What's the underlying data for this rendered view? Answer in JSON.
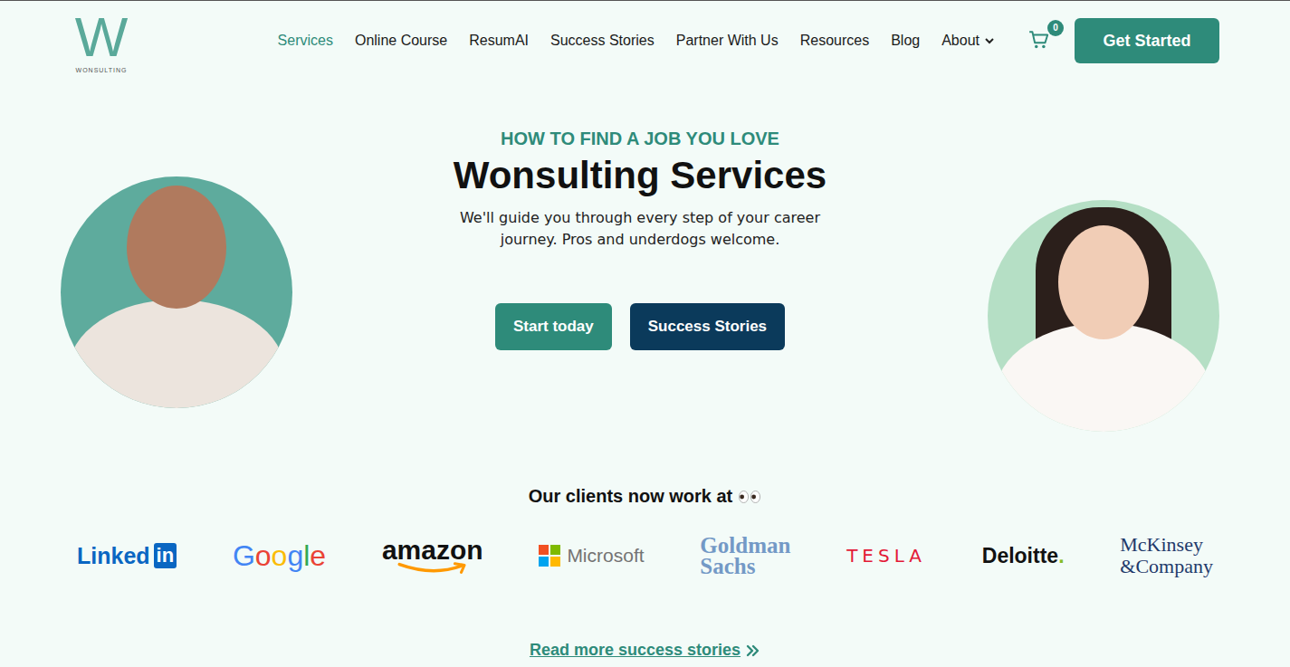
{
  "logo": {
    "letter": "W",
    "wordmark": "WONSULTING"
  },
  "nav": [
    {
      "label": "Services",
      "selected": true,
      "kind": "link"
    },
    {
      "label": "Online Course",
      "selected": false,
      "kind": "link"
    },
    {
      "label": "ResumAI",
      "selected": false,
      "kind": "link"
    },
    {
      "label": "Success Stories",
      "selected": false,
      "kind": "link"
    },
    {
      "label": "Partner With Us",
      "selected": false,
      "kind": "link"
    },
    {
      "label": "Resources",
      "selected": false,
      "kind": "link"
    },
    {
      "label": "Blog",
      "selected": false,
      "kind": "link"
    },
    {
      "label": "About",
      "selected": false,
      "kind": "dropdown"
    }
  ],
  "cart": {
    "count": "0"
  },
  "cta": "Get Started",
  "hero": {
    "eyebrow": "HOW TO FIND A JOB YOU LOVE",
    "title": "Wonsulting Services",
    "subtitle": "We'll guide you through every step of your career journey. Pros and underdogs welcome.",
    "buttons": [
      {
        "label": "Start today",
        "kind": "primary"
      },
      {
        "label": "Success Stories",
        "kind": "secondary"
      }
    ]
  },
  "clients": {
    "heading": "Our clients now work at",
    "logos": [
      {
        "kind": "linkedin",
        "text": "Linked",
        "badge": "in",
        "color": "#0a66c2"
      },
      {
        "kind": "google",
        "letters": [
          {
            "char": "G",
            "color": "#4285f4"
          },
          {
            "char": "o",
            "color": "#ea4335"
          },
          {
            "char": "o",
            "color": "#fbbc05"
          },
          {
            "char": "g",
            "color": "#4285f4"
          },
          {
            "char": "l",
            "color": "#34a853"
          },
          {
            "char": "e",
            "color": "#ea4335"
          }
        ]
      },
      {
        "kind": "amazon",
        "text": "amazon",
        "color": "#111111"
      },
      {
        "kind": "microsoft",
        "text": "Microsoft",
        "color": "#737373"
      },
      {
        "kind": "stacked",
        "lines": [
          "Goldman",
          "Sachs"
        ],
        "color": "#7399c6"
      },
      {
        "kind": "tesla",
        "text": "TESLA",
        "color": "#e31937"
      },
      {
        "kind": "deloitte",
        "text": "Deloitte",
        "dot": ".",
        "color": "#111111"
      },
      {
        "kind": "mckinsey",
        "lines": [
          "McKinsey",
          "&Company"
        ],
        "color": "#1f3a6b"
      }
    ]
  },
  "more_link": "Read more success stories"
}
